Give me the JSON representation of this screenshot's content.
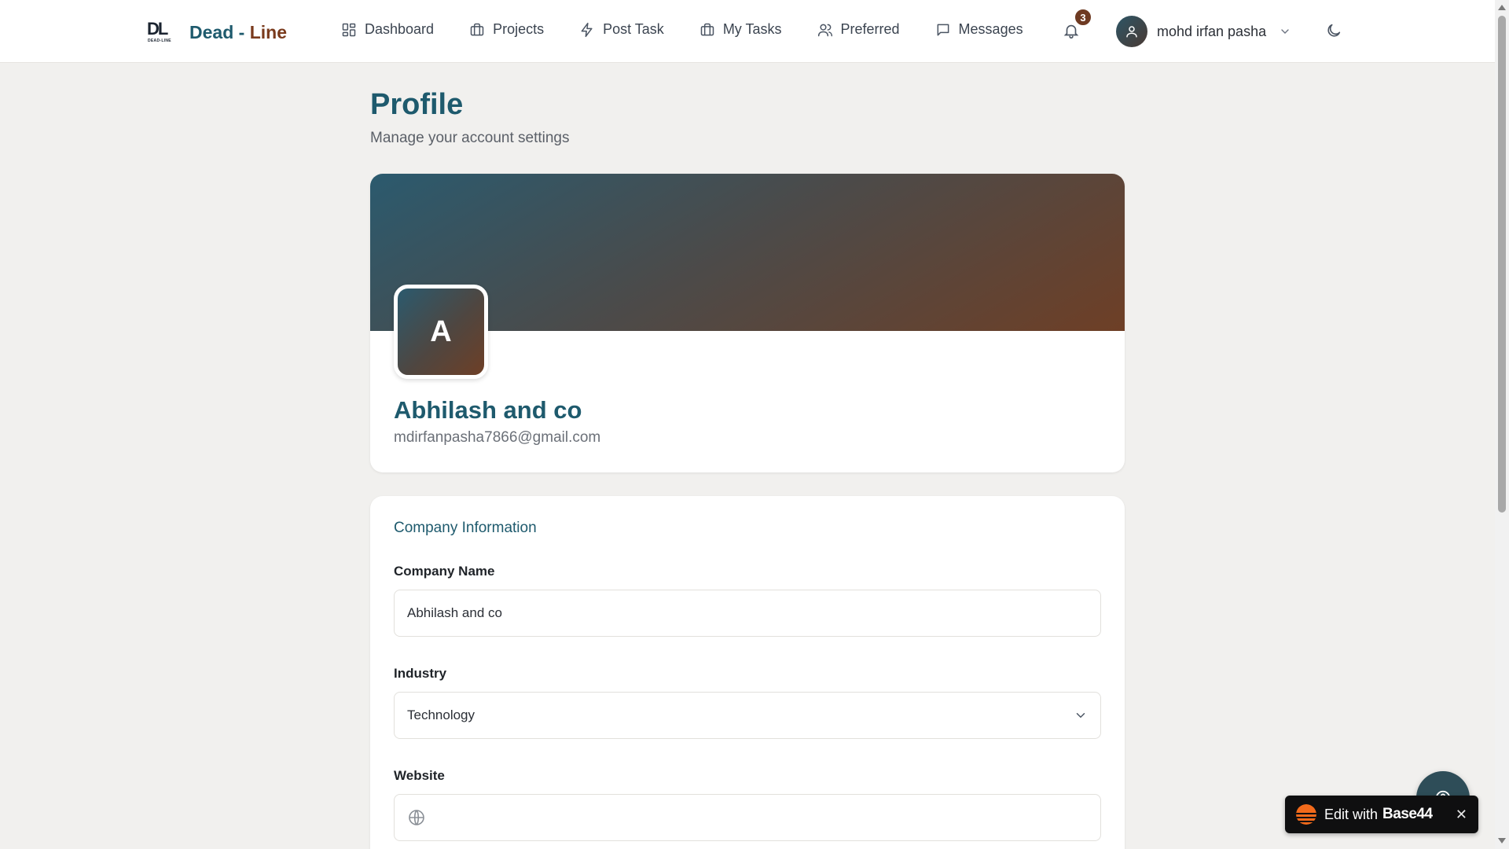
{
  "brand": {
    "mark": "DL",
    "mark_sub": "DEAD-LINE",
    "name_part1": "Dead",
    "name_sep": "-",
    "name_part2": "Line"
  },
  "nav": {
    "items": [
      {
        "label": "Dashboard",
        "icon": "dashboard-icon"
      },
      {
        "label": "Projects",
        "icon": "briefcase-icon"
      },
      {
        "label": "Post Task",
        "icon": "lightning-icon"
      },
      {
        "label": "My Tasks",
        "icon": "briefcase-icon"
      },
      {
        "label": "Preferred",
        "icon": "users-icon"
      },
      {
        "label": "Messages",
        "icon": "message-icon"
      }
    ],
    "notification_count": "3",
    "user_name": "mohd irfan pasha"
  },
  "page": {
    "title": "Profile",
    "subtitle": "Manage your account settings"
  },
  "profile": {
    "initial": "A",
    "company_name": "Abhilash and co",
    "email": "mdirfanpasha7866@gmail.com"
  },
  "company_info": {
    "section_title": "Company Information",
    "company_name_label": "Company Name",
    "company_name_value": "Abhilash and co",
    "industry_label": "Industry",
    "industry_value": "Technology",
    "website_label": "Website",
    "website_value": ""
  },
  "widget": {
    "label": "Edit with",
    "brand": "Base44",
    "close": "✕"
  },
  "colors": {
    "primary": "#1e5a6d",
    "accent": "#7a3a1c",
    "background": "#f1f0ee"
  }
}
